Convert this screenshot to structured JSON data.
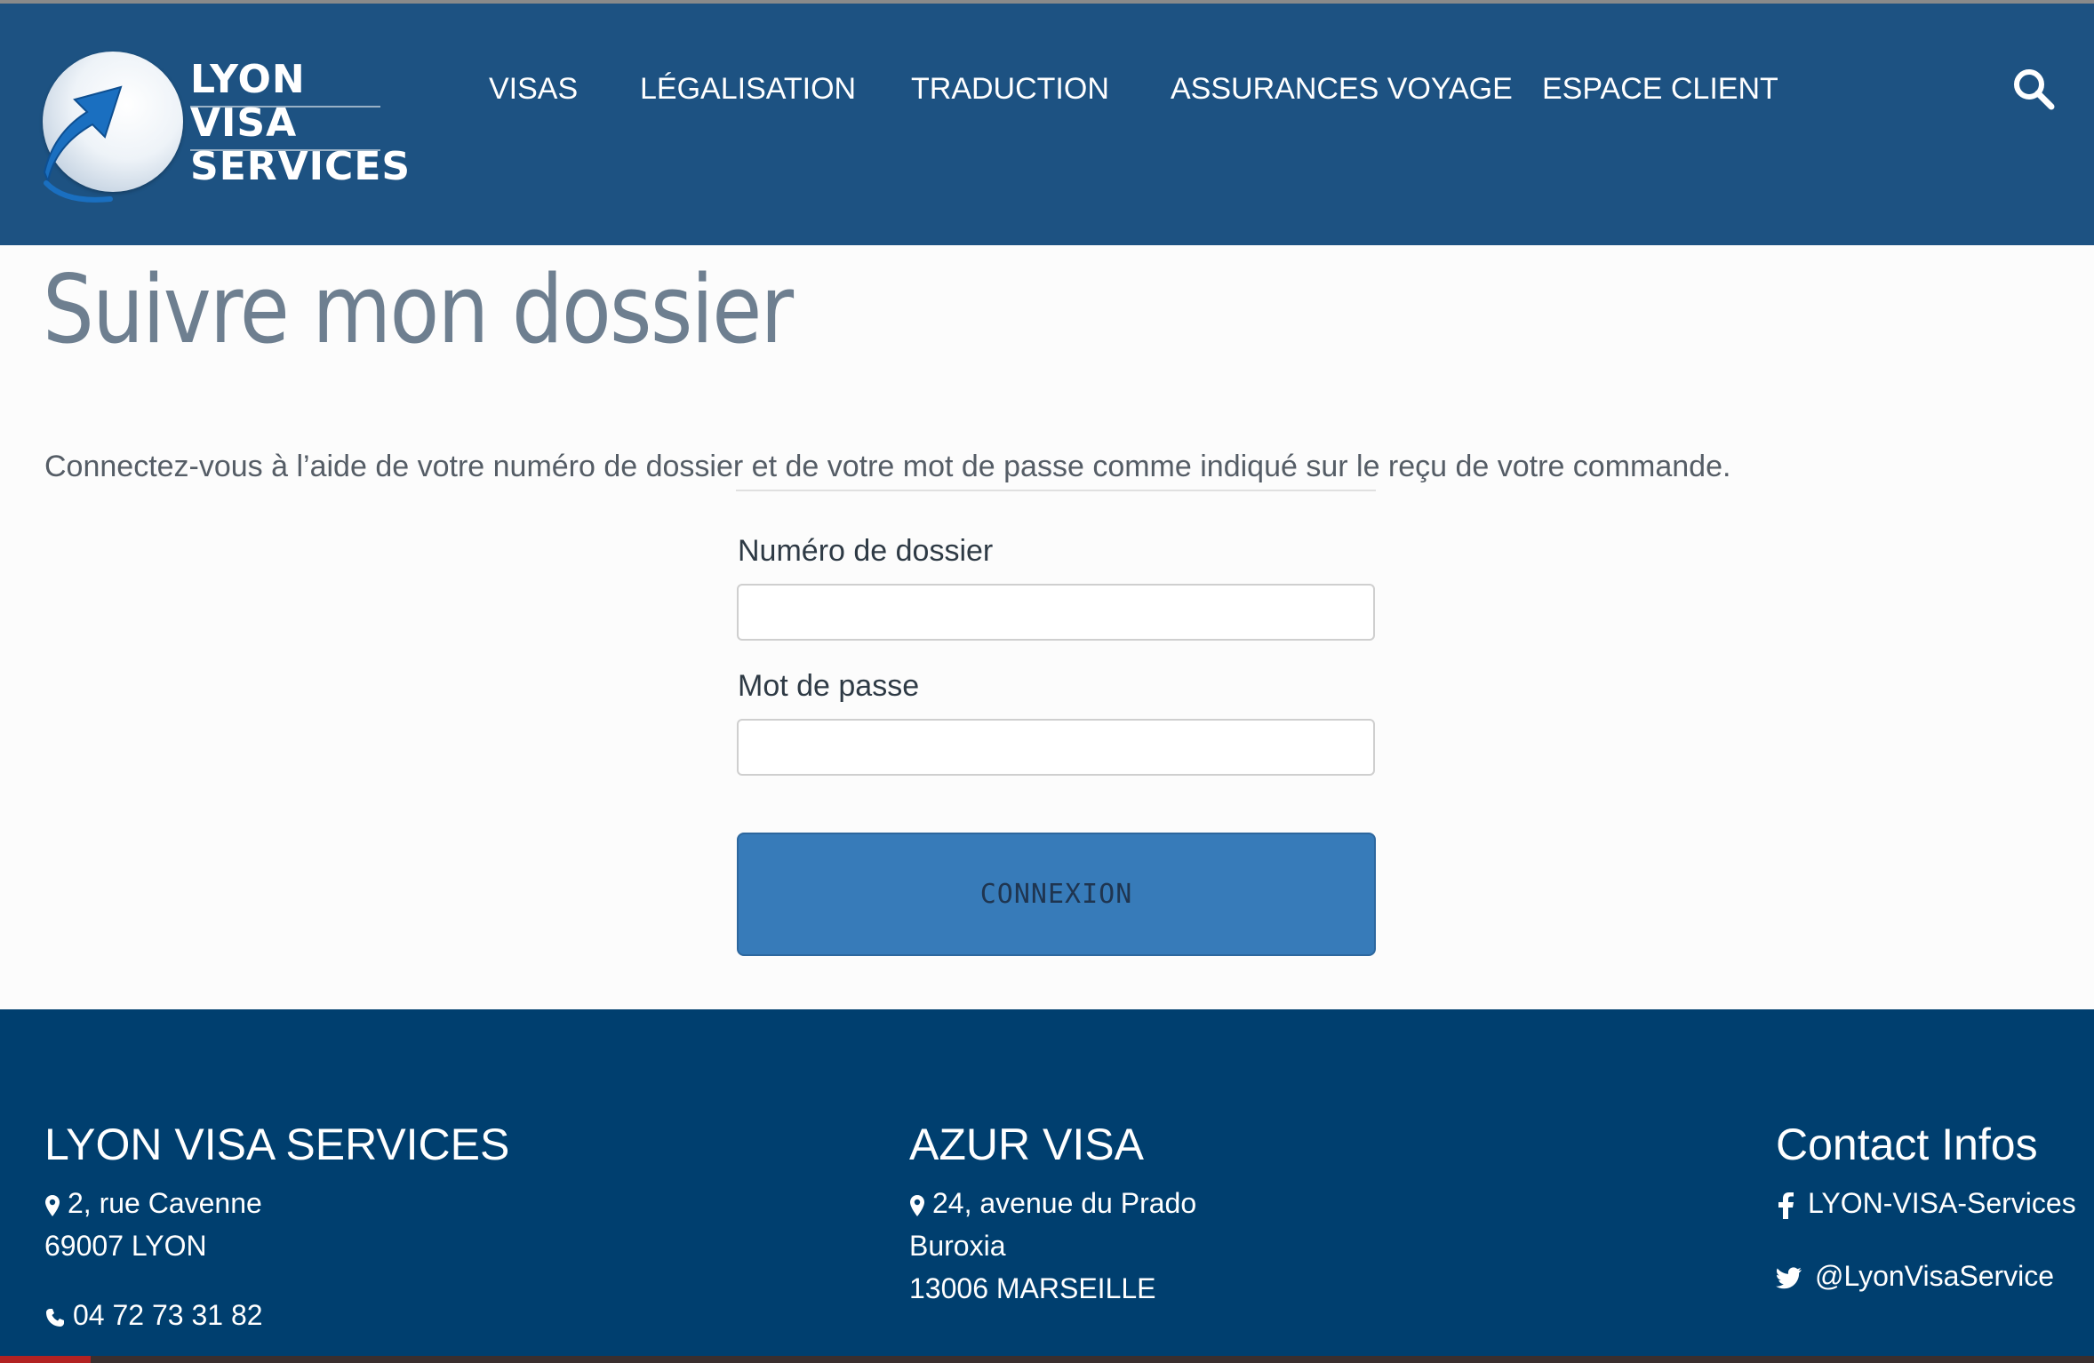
{
  "logo": {
    "line1": "LYON",
    "line2": "VISA",
    "line3": "SERVICES",
    "icon": "globe-arrow-logo"
  },
  "nav": {
    "items": [
      {
        "label": "VISAS"
      },
      {
        "label": "LÉGALISATION"
      },
      {
        "label": "TRADUCTION"
      },
      {
        "label": "ASSURANCES VOYAGE"
      },
      {
        "label": "ESPACE CLIENT"
      }
    ],
    "search_icon": "search-icon"
  },
  "main": {
    "title": "Suivre mon dossier",
    "intro": "Connectez-vous à l’aide de votre numéro de dossier et de votre mot de passe comme indiqué sur le reçu de votre commande.",
    "form": {
      "dossier_label": "Numéro de dossier",
      "dossier_value": "",
      "password_label": "Mot de passe",
      "password_value": "",
      "submit_label": "CONNEXION"
    }
  },
  "footer": {
    "lyon": {
      "title": "LYON VISA SERVICES",
      "address_line1": "2, rue Cavenne",
      "address_line2": "69007 LYON",
      "phone": "04 72 73 31 82"
    },
    "azur": {
      "title": "AZUR VISA",
      "address_line1": "24, avenue du Prado",
      "address_line2": "Buroxia",
      "address_line3": "13006 MARSEILLE"
    },
    "contact": {
      "title": "Contact Infos",
      "facebook": "LYON-VISA-Services",
      "twitter": "@LyonVisaService"
    }
  },
  "colors": {
    "header_bg": "#1d5282",
    "footer_bg": "#003f6f",
    "button_bg": "#377bb9",
    "title_color": "#6e7f90"
  }
}
